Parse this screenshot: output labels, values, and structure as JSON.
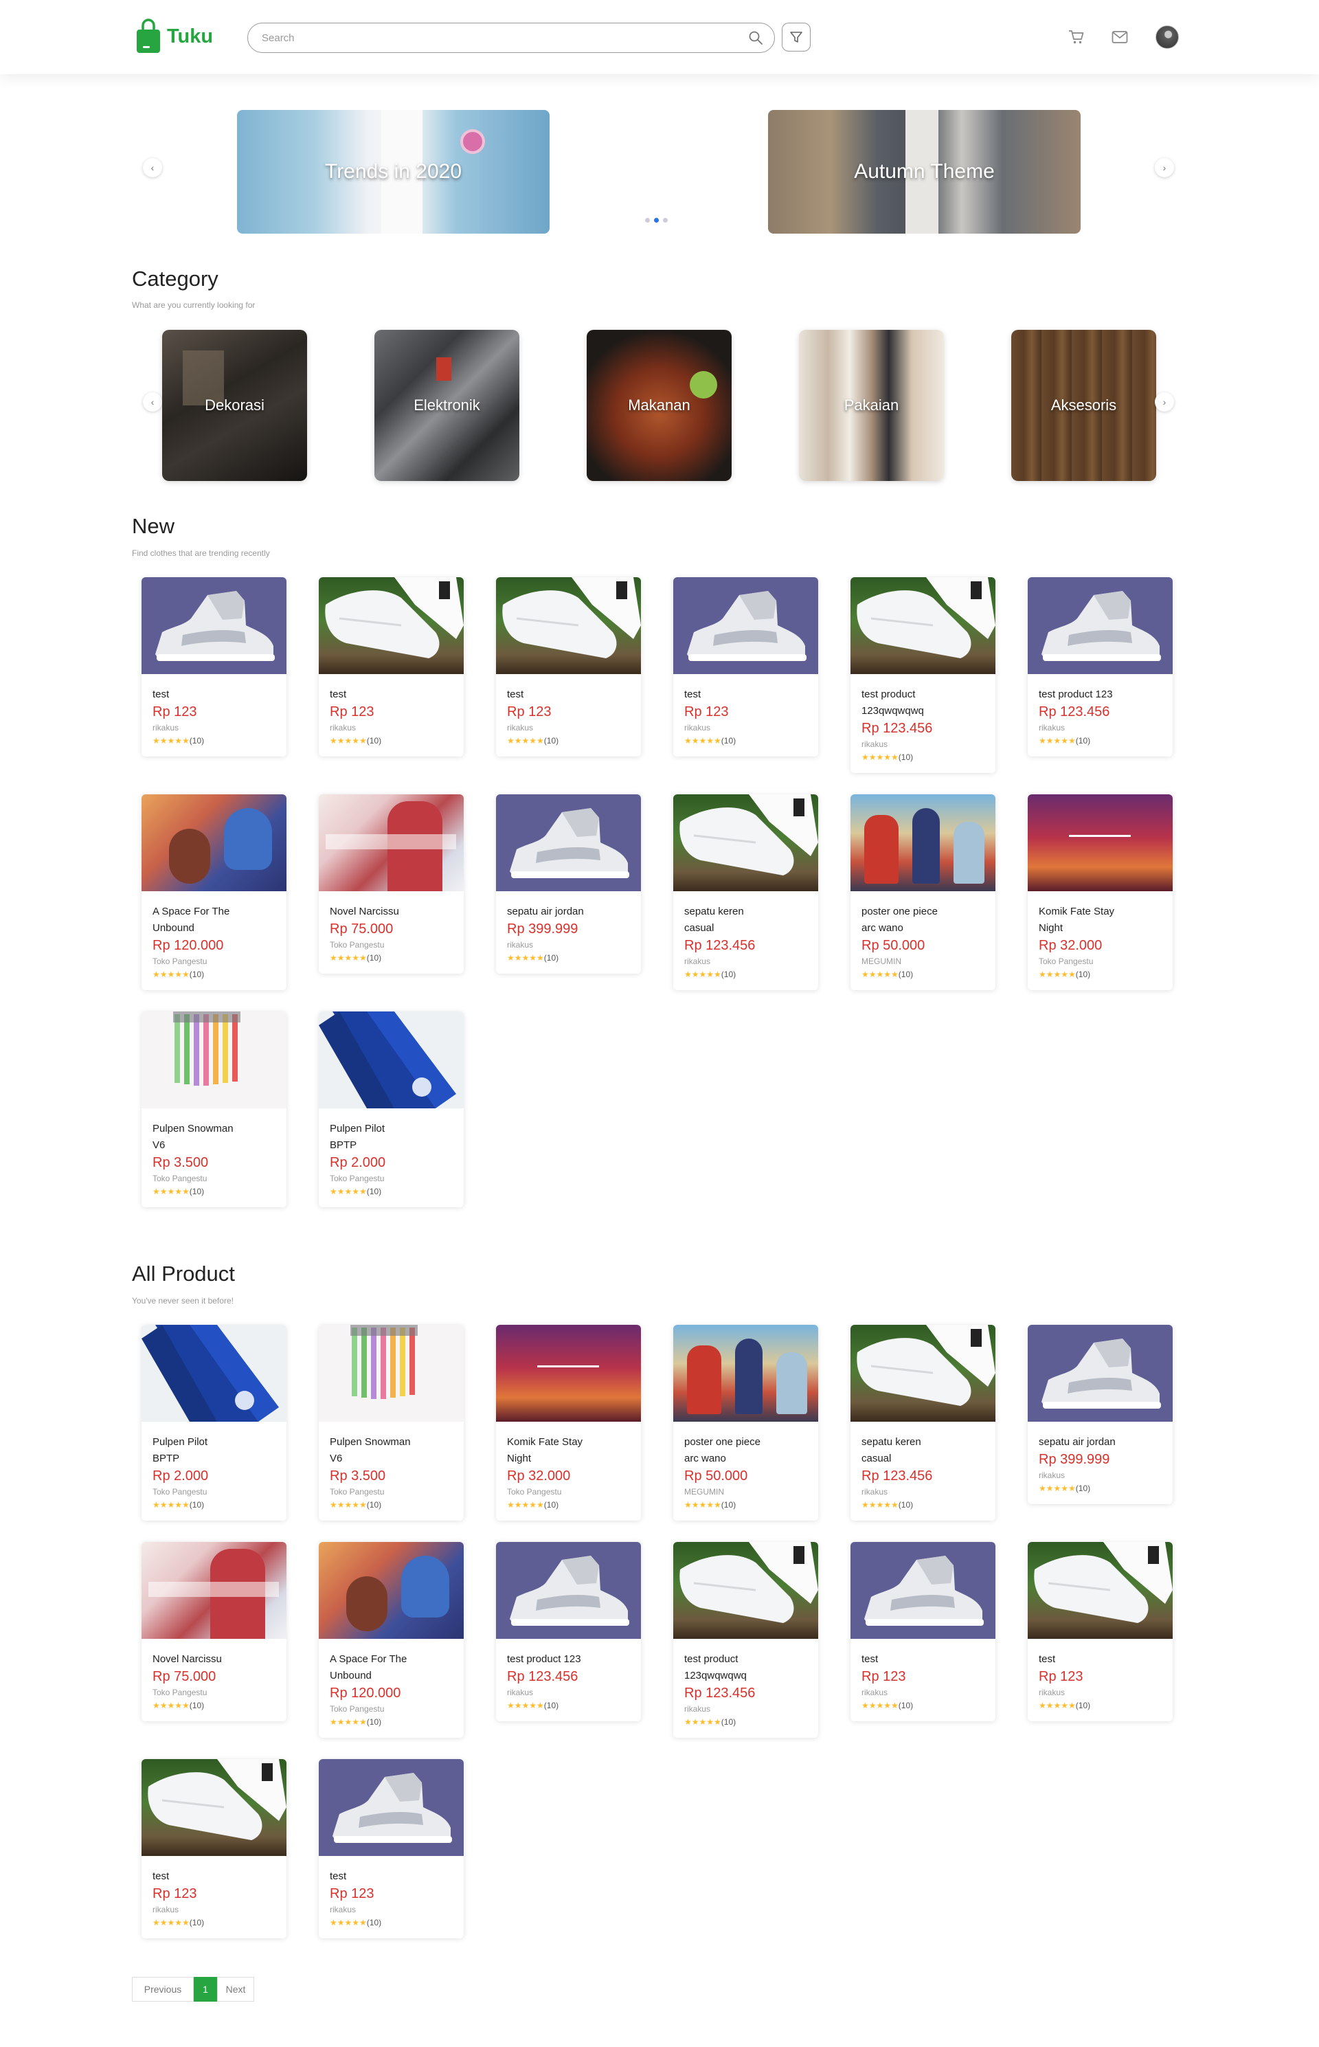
{
  "header": {
    "logo_text": "Tuku",
    "search_placeholder": "Search",
    "brand_color": "#26a541",
    "icons": [
      "search-icon",
      "filter-icon",
      "cart-icon",
      "mail-icon",
      "avatar"
    ]
  },
  "banners": [
    {
      "title": "Trends in 2020"
    },
    {
      "title": "Autumn Theme"
    }
  ],
  "carousel": {
    "active_dot": 2,
    "dot_count": 3
  },
  "category": {
    "title": "Category",
    "subtitle": "What are you currently looking for",
    "items": [
      {
        "label": "Dekorasi"
      },
      {
        "label": "Elektronik"
      },
      {
        "label": "Makanan"
      },
      {
        "label": "Pakaian"
      },
      {
        "label": "Aksesoris"
      }
    ]
  },
  "new_section": {
    "title": "New",
    "subtitle": "Find clothes that are trending recently",
    "products": [
      {
        "name": "test",
        "price": "Rp 123",
        "store": "rikakus",
        "rating": "(10)",
        "image": "jordan"
      },
      {
        "name": "test",
        "price": "Rp 123",
        "store": "rikakus",
        "rating": "(10)",
        "image": "white-sneaker"
      },
      {
        "name": "test",
        "price": "Rp 123",
        "store": "rikakus",
        "rating": "(10)",
        "image": "white-sneaker"
      },
      {
        "name": "test",
        "price": "Rp 123",
        "store": "rikakus",
        "rating": "(10)",
        "image": "jordan"
      },
      {
        "name": "test product 123qwqwqwq",
        "price": "Rp 123.456",
        "store": "rikakus",
        "rating": "(10)",
        "image": "white-sneaker"
      },
      {
        "name": "test product 123",
        "price": "Rp 123.456",
        "store": "rikakus",
        "rating": "(10)",
        "image": "jordan"
      },
      {
        "name": "A Space For The Unbound",
        "price": "Rp 120.000",
        "store": "Toko Pangestu",
        "rating": "(10)",
        "image": "anime-space"
      },
      {
        "name": "Novel Narcissu",
        "price": "Rp 75.000",
        "store": "Toko Pangestu",
        "rating": "(10)",
        "image": "narcissu"
      },
      {
        "name": "sepatu air jordan",
        "price": "Rp 399.999",
        "store": "rikakus",
        "rating": "(10)",
        "image": "jordan"
      },
      {
        "name": "sepatu keren casual",
        "price": "Rp 123.456",
        "store": "rikakus",
        "rating": "(10)",
        "image": "white-sneaker"
      },
      {
        "name": "poster one piece arc wano",
        "price": "Rp 50.000",
        "store": "MEGUMIN",
        "rating": "(10)",
        "image": "onepiece"
      },
      {
        "name": "Komik Fate Stay Night",
        "price": "Rp 32.000",
        "store": "Toko Pangestu",
        "rating": "(10)",
        "image": "fate"
      },
      {
        "name": "Pulpen Snowman V6",
        "price": "Rp 3.500",
        "store": "Toko Pangestu",
        "rating": "(10)",
        "image": "pens-color"
      },
      {
        "name": "Pulpen Pilot BPTP",
        "price": "Rp 2.000",
        "store": "Toko Pangestu",
        "rating": "(10)",
        "image": "pens-blue"
      }
    ]
  },
  "all_section": {
    "title": "All Product",
    "subtitle": "You've never seen it before!",
    "products": [
      {
        "name": "Pulpen Pilot BPTP",
        "price": "Rp 2.000",
        "store": "Toko Pangestu",
        "rating": "(10)",
        "image": "pens-blue"
      },
      {
        "name": "Pulpen Snowman V6",
        "price": "Rp 3.500",
        "store": "Toko Pangestu",
        "rating": "(10)",
        "image": "pens-color"
      },
      {
        "name": "Komik Fate Stay Night",
        "price": "Rp 32.000",
        "store": "Toko Pangestu",
        "rating": "(10)",
        "image": "fate"
      },
      {
        "name": "poster one piece arc wano",
        "price": "Rp 50.000",
        "store": "MEGUMIN",
        "rating": "(10)",
        "image": "onepiece"
      },
      {
        "name": "sepatu keren casual",
        "price": "Rp 123.456",
        "store": "rikakus",
        "rating": "(10)",
        "image": "white-sneaker"
      },
      {
        "name": "sepatu air jordan",
        "price": "Rp 399.999",
        "store": "rikakus",
        "rating": "(10)",
        "image": "jordan"
      },
      {
        "name": "Novel Narcissu",
        "price": "Rp 75.000",
        "store": "Toko Pangestu",
        "rating": "(10)",
        "image": "narcissu"
      },
      {
        "name": "A Space For The Unbound",
        "price": "Rp 120.000",
        "store": "Toko Pangestu",
        "rating": "(10)",
        "image": "anime-space"
      },
      {
        "name": "test product 123",
        "price": "Rp 123.456",
        "store": "rikakus",
        "rating": "(10)",
        "image": "jordan"
      },
      {
        "name": "test product 123qwqwqwq",
        "price": "Rp 123.456",
        "store": "rikakus",
        "rating": "(10)",
        "image": "white-sneaker"
      },
      {
        "name": "test",
        "price": "Rp 123",
        "store": "rikakus",
        "rating": "(10)",
        "image": "jordan"
      },
      {
        "name": "test",
        "price": "Rp 123",
        "store": "rikakus",
        "rating": "(10)",
        "image": "white-sneaker"
      },
      {
        "name": "test",
        "price": "Rp 123",
        "store": "rikakus",
        "rating": "(10)",
        "image": "white-sneaker"
      },
      {
        "name": "test",
        "price": "Rp 123",
        "store": "rikakus",
        "rating": "(10)",
        "image": "jordan"
      }
    ]
  },
  "pagination": {
    "previous": "Previous",
    "current": "1",
    "next": "Next"
  },
  "stars": "★★★★★",
  "colors": {
    "price": "#d9312b",
    "star": "#ffbd2e",
    "accent": "#26a541"
  }
}
